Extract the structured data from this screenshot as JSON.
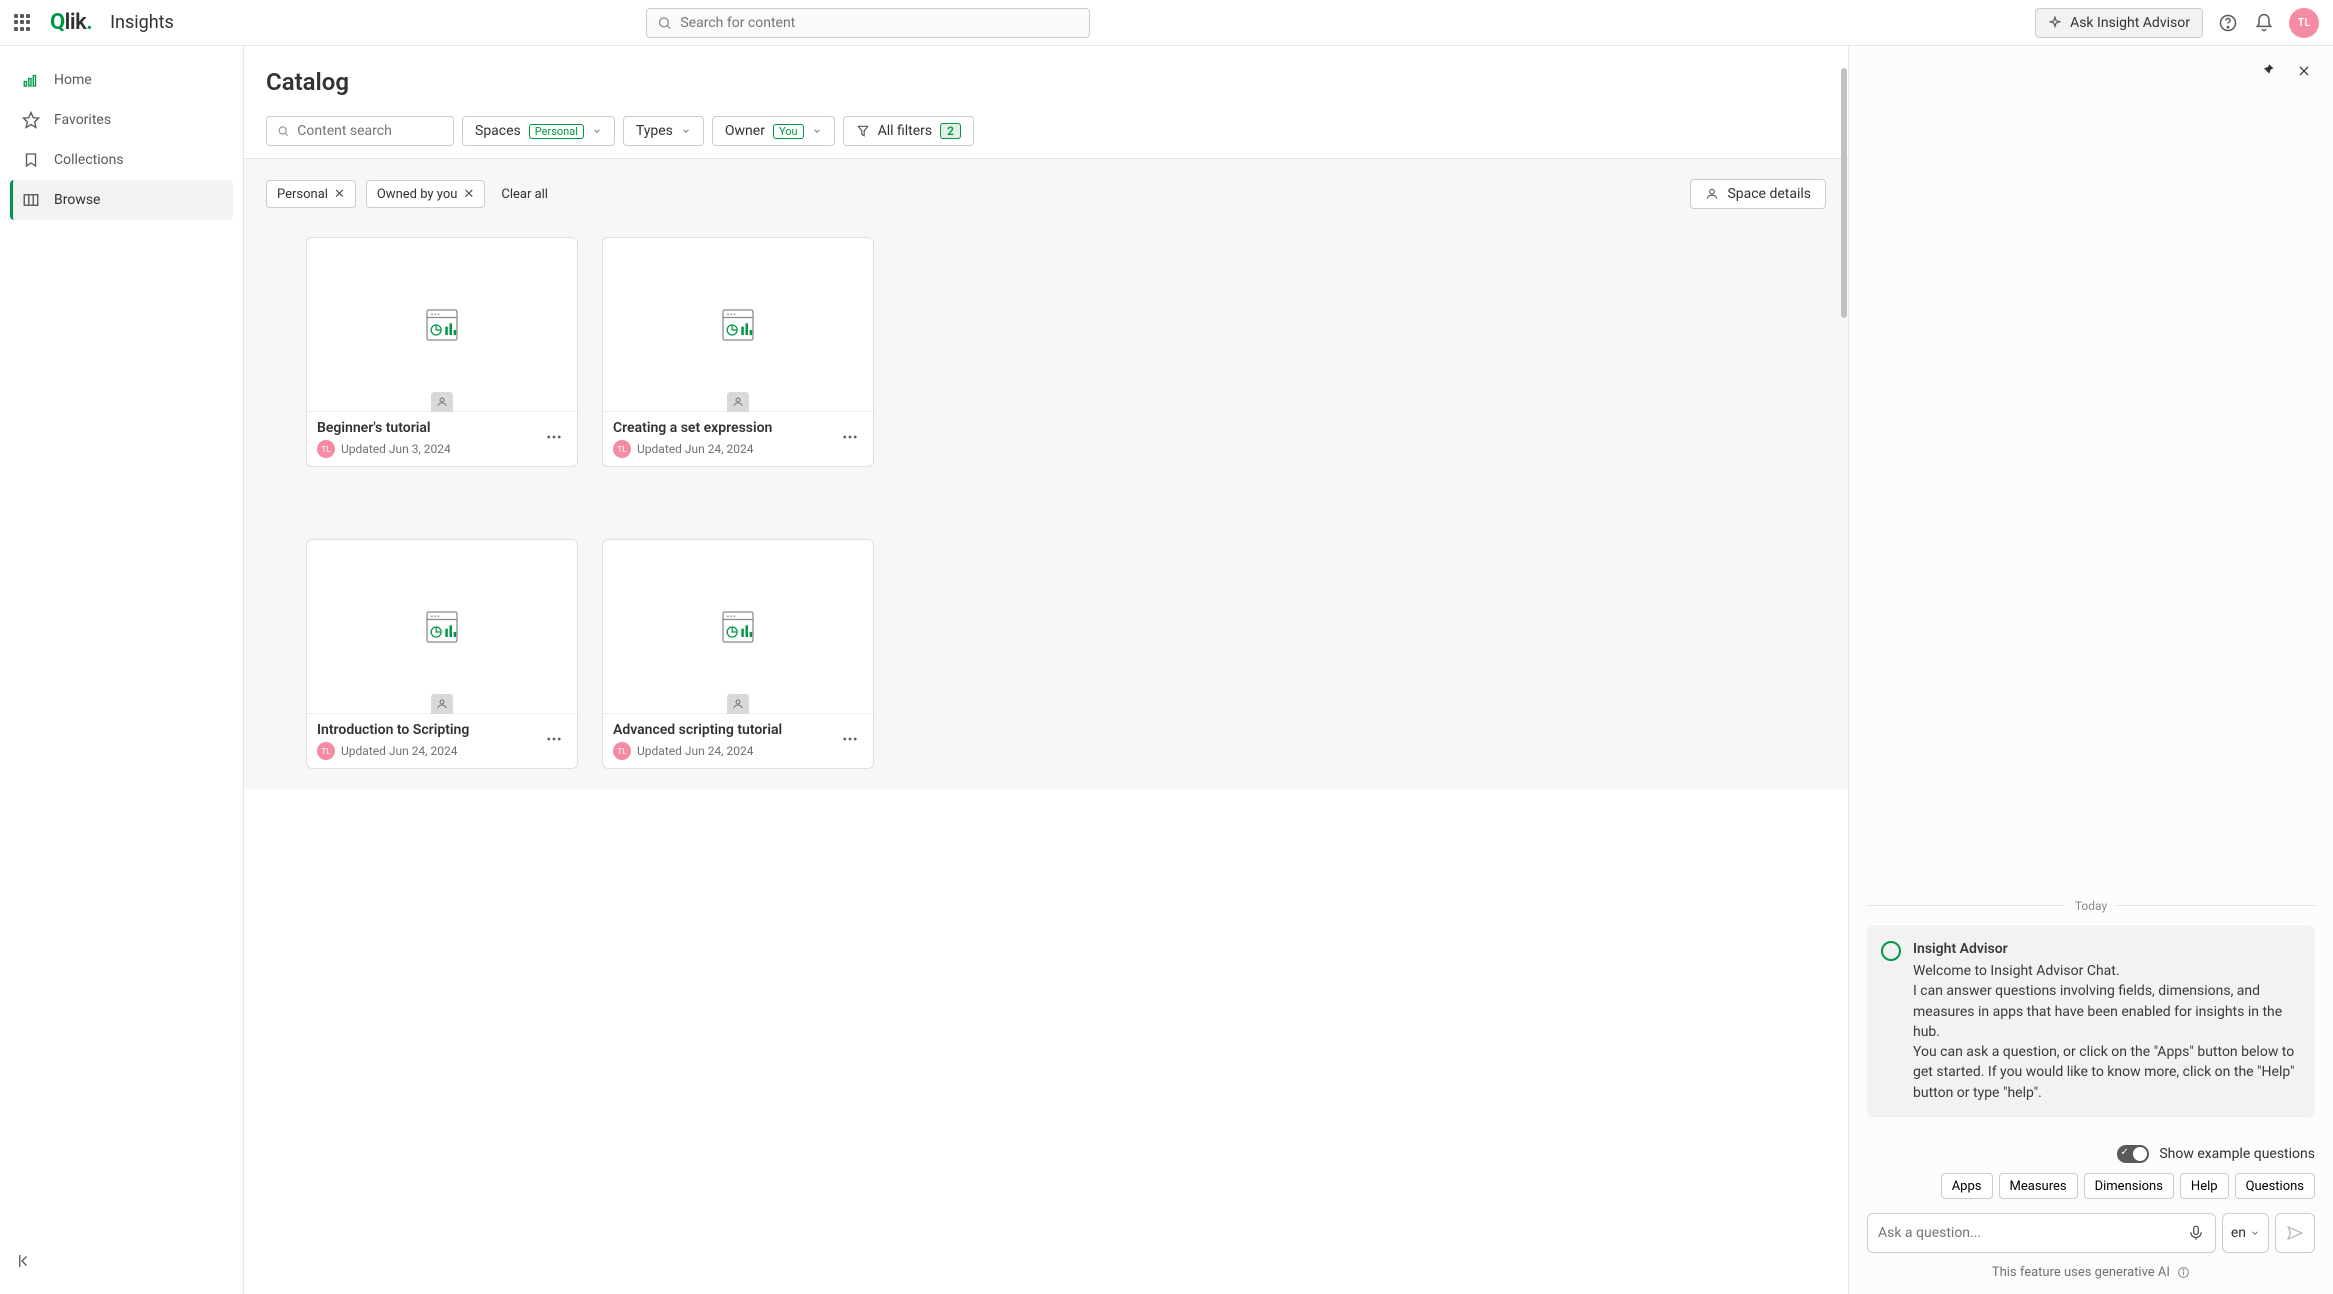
{
  "header": {
    "brand": "Insights",
    "search_placeholder": "Search for content",
    "ask_label": "Ask Insight Advisor",
    "avatar_initials": "TL"
  },
  "sidebar": {
    "items": [
      {
        "label": "Home"
      },
      {
        "label": "Favorites"
      },
      {
        "label": "Collections"
      },
      {
        "label": "Browse"
      }
    ]
  },
  "main": {
    "title": "Catalog",
    "content_search_placeholder": "Content search",
    "filters": {
      "spaces_label": "Spaces",
      "spaces_value": "Personal",
      "types_label": "Types",
      "owner_label": "Owner",
      "owner_value": "You",
      "all_filters_label": "All filters",
      "all_filters_count": "2"
    },
    "applied": [
      {
        "label": "Personal"
      },
      {
        "label": "Owned by you"
      }
    ],
    "clear_all": "Clear all",
    "space_details": "Space details",
    "cards": [
      {
        "title": "Beginner's tutorial",
        "updated": "Updated Jun 3, 2024",
        "initials": "TL"
      },
      {
        "title": "Creating a set expression",
        "updated": "Updated Jun 24, 2024",
        "initials": "TL"
      },
      {
        "title": "Introduction to Scripting",
        "updated": "Updated Jun 24, 2024",
        "initials": "TL"
      },
      {
        "title": "Advanced scripting tutorial",
        "updated": "Updated Jun 24, 2024",
        "initials": "TL"
      }
    ]
  },
  "chat": {
    "divider_label": "Today",
    "bot_name": "Insight Advisor",
    "msg_line1": "Welcome to Insight Advisor Chat.",
    "msg_line2": "I can answer questions involving fields, dimensions, and measures in apps that have been enabled for insights in the hub.",
    "msg_line3": "You can ask a question, or click on the \"Apps\" button below to get started. If you would like to know more, click on the \"Help\" button or type \"help\".",
    "toggle_label": "Show example questions",
    "quick": [
      "Apps",
      "Measures",
      "Dimensions",
      "Help",
      "Questions"
    ],
    "ask_placeholder": "Ask a question...",
    "lang": "en",
    "genai_note": "This feature uses generative AI"
  }
}
